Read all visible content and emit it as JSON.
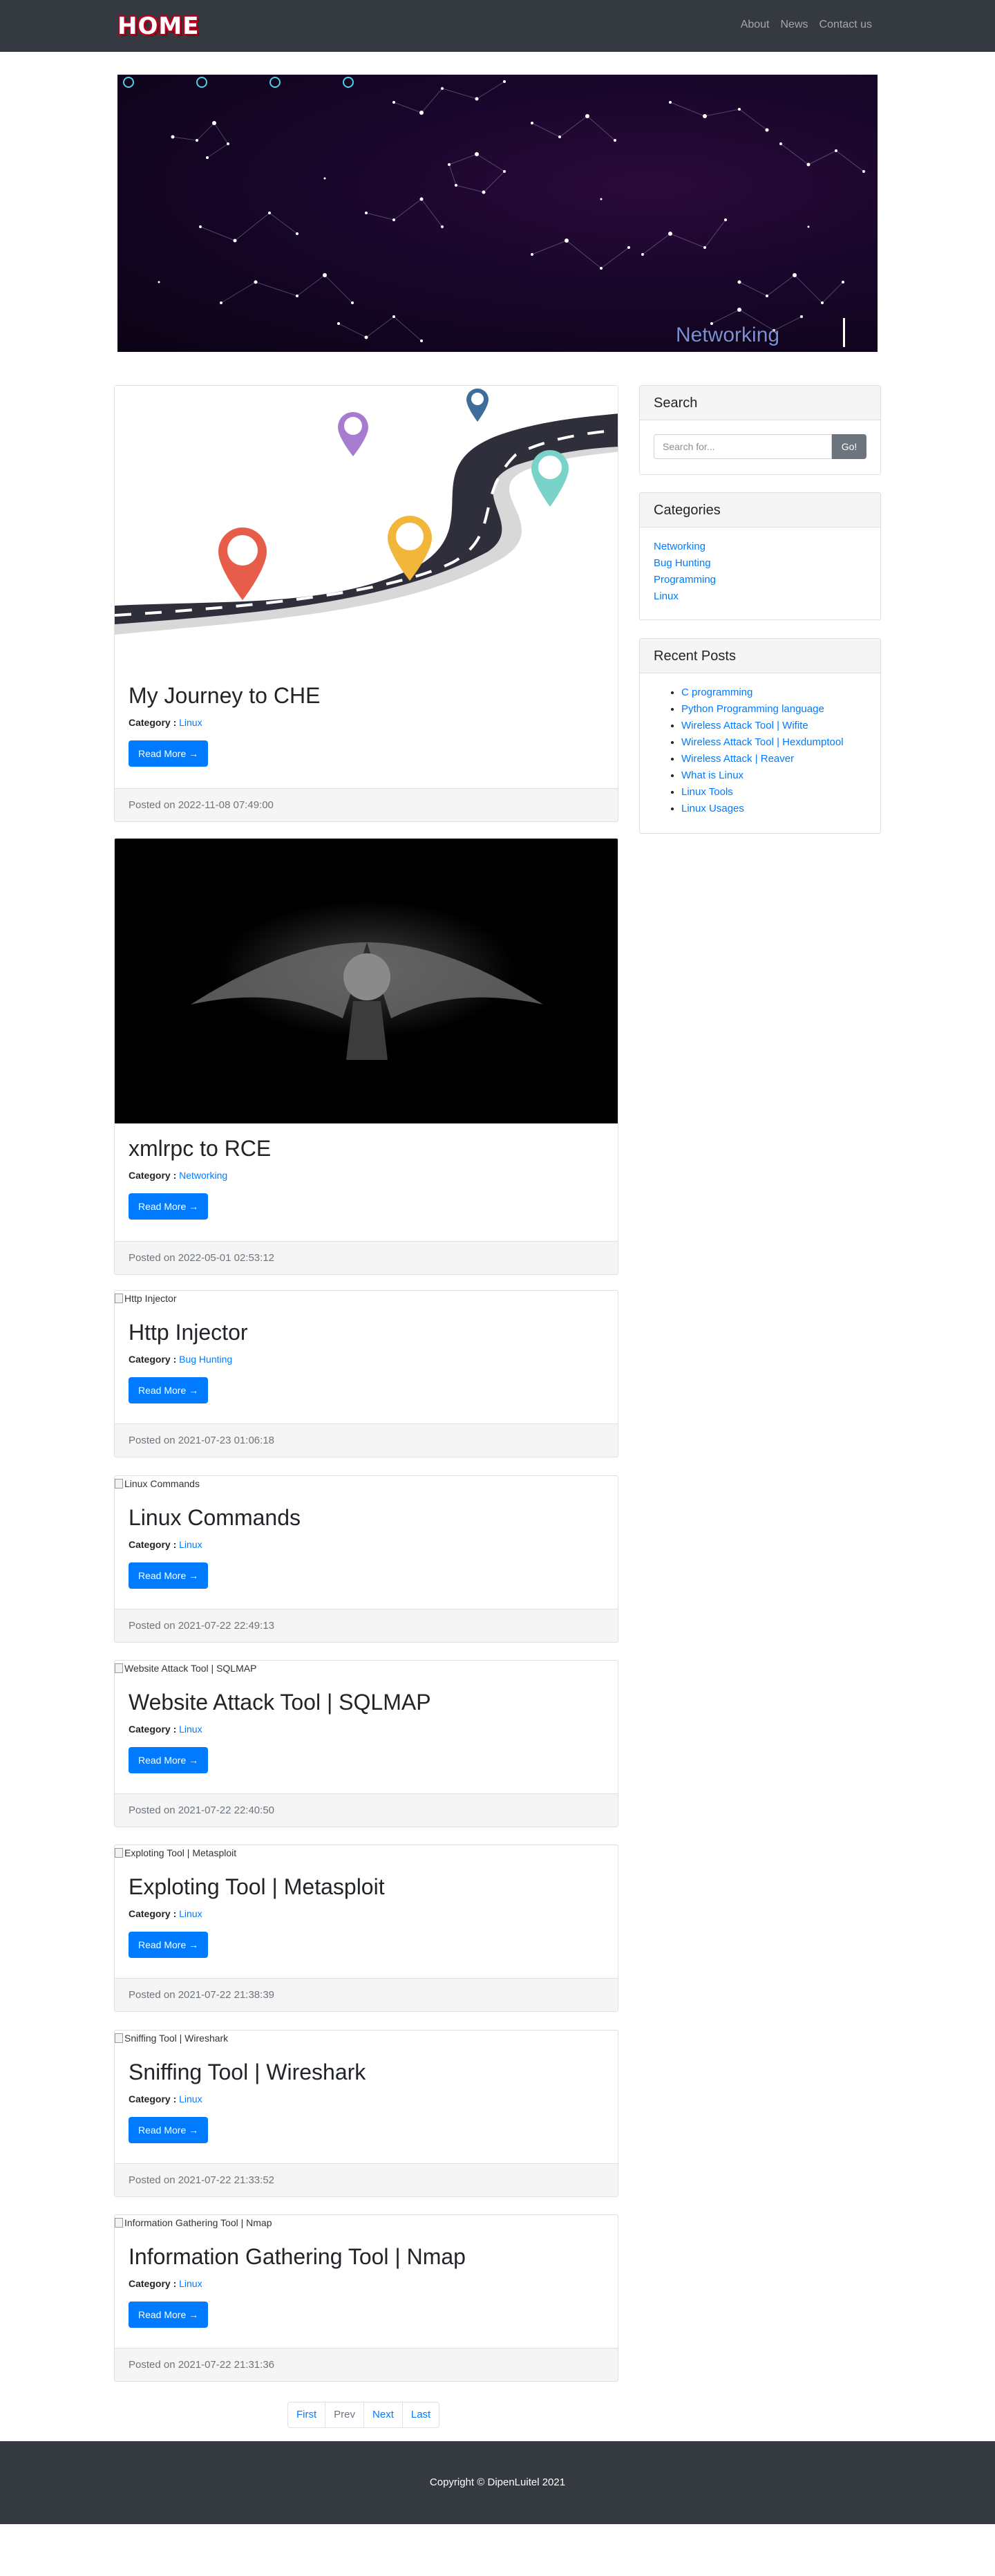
{
  "navbar": {
    "brand": "HOME",
    "links": [
      {
        "label": "About"
      },
      {
        "label": "News"
      },
      {
        "label": "Contact us"
      }
    ]
  },
  "hero": {
    "caption": "Networking",
    "indicators": 4
  },
  "posts": [
    {
      "title": "My Journey to CHE",
      "category_label": "Category :",
      "category": "Linux",
      "read_more": "Read More →",
      "posted": "Posted on 2022-11-08 07:49:00",
      "image_alt": ""
    },
    {
      "title": "xmlrpc to RCE",
      "category_label": "Category :",
      "category": "Networking",
      "read_more": "Read More →",
      "posted": "Posted on 2022-05-01 02:53:12",
      "image_alt": ""
    },
    {
      "title": "Http Injector",
      "category_label": "Category :",
      "category": "Bug Hunting",
      "read_more": "Read More →",
      "posted": "Posted on 2021-07-23 01:06:18",
      "image_alt": "Http Injector"
    },
    {
      "title": "Linux Commands",
      "category_label": "Category :",
      "category": "Linux",
      "read_more": "Read More →",
      "posted": "Posted on 2021-07-22 22:49:13",
      "image_alt": "Linux Commands"
    },
    {
      "title": "Website Attack Tool | SQLMAP",
      "category_label": "Category :",
      "category": "Linux",
      "read_more": "Read More →",
      "posted": "Posted on 2021-07-22 22:40:50",
      "image_alt": "Website Attack Tool | SQLMAP"
    },
    {
      "title": "Exploting Tool | Metasploit",
      "category_label": "Category :",
      "category": "Linux",
      "read_more": "Read More →",
      "posted": "Posted on 2021-07-22 21:38:39",
      "image_alt": "Exploting Tool | Metasploit"
    },
    {
      "title": "Sniffing Tool | Wireshark",
      "category_label": "Category :",
      "category": "Linux",
      "read_more": "Read More →",
      "posted": "Posted on 2021-07-22 21:33:52",
      "image_alt": "Sniffing Tool | Wireshark"
    },
    {
      "title": "Information Gathering Tool | Nmap",
      "category_label": "Category :",
      "category": "Linux",
      "read_more": "Read More →",
      "posted": "Posted on 2021-07-22 21:31:36",
      "image_alt": "Information Gathering Tool | Nmap"
    }
  ],
  "sidebar": {
    "search": {
      "heading": "Search",
      "placeholder": "Search for...",
      "button": "Go!"
    },
    "categories": {
      "heading": "Categories",
      "items": [
        "Networking",
        "Bug Hunting",
        "Programming",
        "Linux"
      ]
    },
    "recent": {
      "heading": "Recent Posts",
      "items": [
        "C programming",
        "Python Programming language",
        "Wireless Attack Tool | Wifite",
        "Wireless Attack Tool | Hexdumptool",
        "Wireless Attack | Reaver",
        "What is Linux",
        "Linux Tools",
        "Linux Usages"
      ]
    }
  },
  "pagination": {
    "items": [
      "First",
      "Prev",
      "Next",
      "Last"
    ]
  },
  "footer": {
    "copyright": "Copyright © DipenLuitel 2021"
  },
  "colors": {
    "navbar": "#343a40",
    "accent": "#007bff",
    "muted": "#6c757d"
  }
}
